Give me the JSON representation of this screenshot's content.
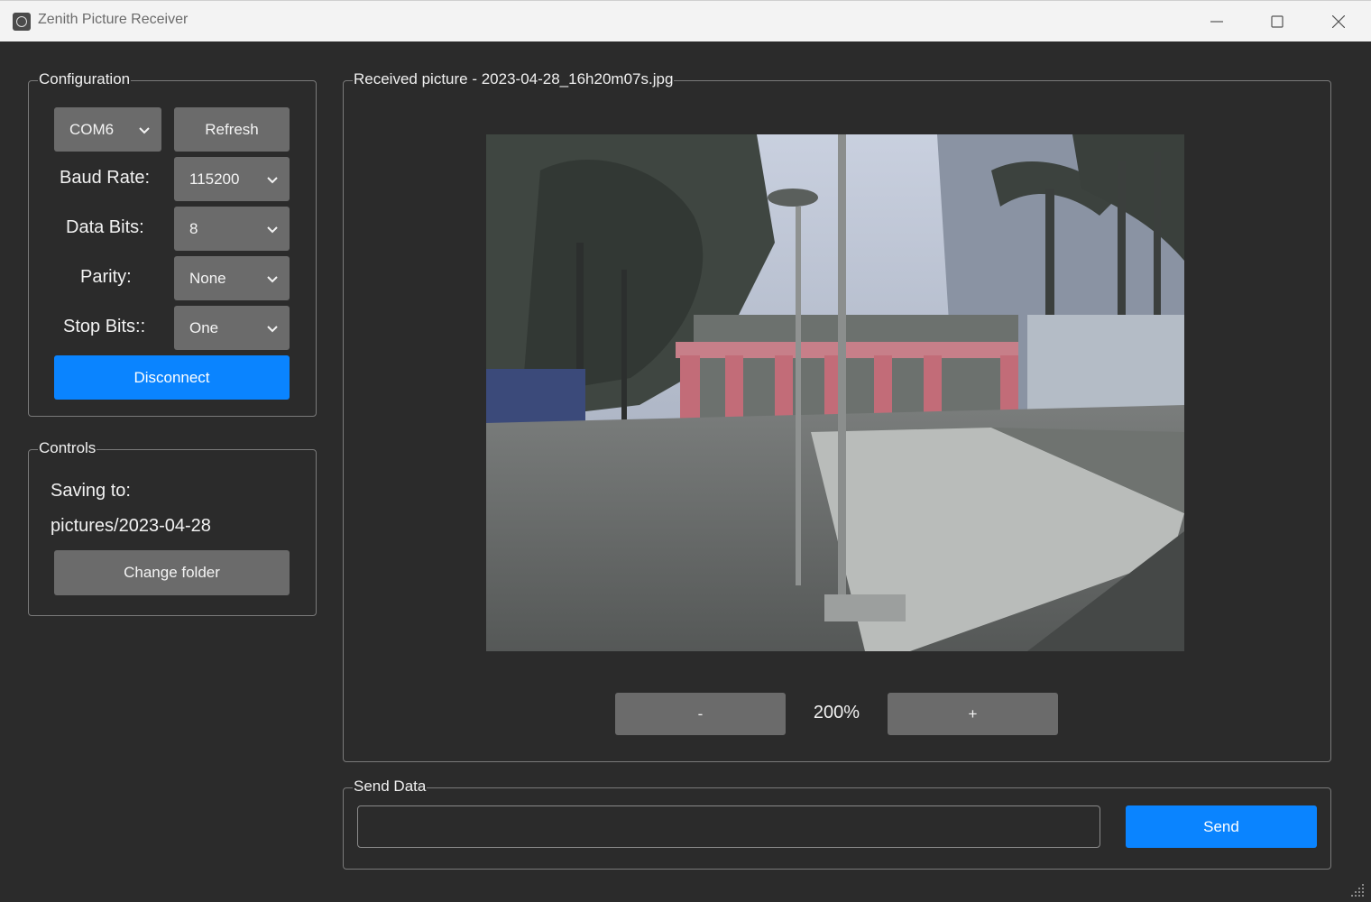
{
  "window": {
    "title": "Zenith Picture Receiver",
    "icons": {
      "minimize": "minimize-icon",
      "maximize": "maximize-icon",
      "close": "close-icon"
    }
  },
  "configuration": {
    "title": "Configuration",
    "port_value": "COM6",
    "refresh_label": "Refresh",
    "baud_label": "Baud Rate:",
    "baud_value": "115200",
    "databits_label": "Data Bits:",
    "databits_value": "8",
    "parity_label": "Parity:",
    "parity_value": "None",
    "stopbits_label": "Stop Bits::",
    "stopbits_value": "One",
    "disconnect_label": "Disconnect"
  },
  "controls": {
    "title": "Controls",
    "saving_label": "Saving to:",
    "saving_path": "pictures/2023-04-28",
    "change_folder_label": "Change folder"
  },
  "picture": {
    "title": "Received picture - 2023-04-28_16h20m07s.jpg",
    "zoom_out_label": "-",
    "zoom_value": "200%",
    "zoom_in_label": "+"
  },
  "send": {
    "title": "Send Data",
    "input_value": "",
    "send_label": "Send"
  },
  "colors": {
    "background": "#2b2b2b",
    "accent": "#0a84ff",
    "button": "#6b6b6b"
  }
}
